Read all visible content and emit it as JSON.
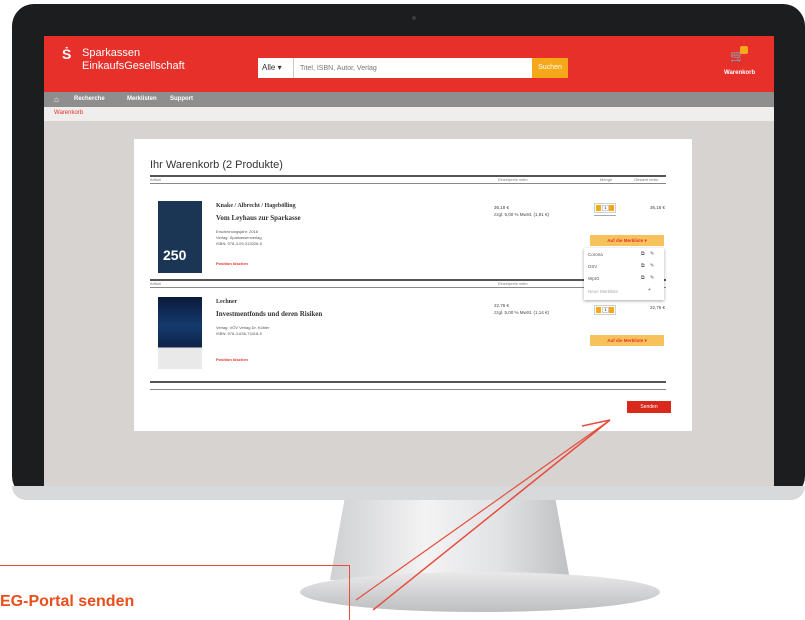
{
  "header": {
    "brand_line1": "Sparkassen",
    "brand_line2": "EinkaufsGesellschaft",
    "search_scope": "Alle",
    "search_placeholder": "Titel, ISBN, Autor, Verlag",
    "search_button": "Suchen",
    "cart_label": "Warenkorb"
  },
  "nav": {
    "items": [
      "Recherche",
      "Merklisten",
      "Support"
    ]
  },
  "breadcrumb": "Warenkorb",
  "cart": {
    "title": "Ihr Warenkorb (2 Produkte)",
    "col_article": "Artikel",
    "col_unit_price": "Einzelpreis netto",
    "col_quantity": "Menge",
    "col_total": "Gesamt netto",
    "items": [
      {
        "author": "Knake / Albrecht / Hagebölling",
        "title": "Vom Leyhaus zur Sparkasse",
        "meta": [
          "Erscheinungsjahr: 2016",
          "Verlag: Sparkassenverlag",
          "ISBN: 978-3-09-313026-5"
        ],
        "price": "36,18 €",
        "price_note": "zzgl. 5,00 % MwSt. (1,81 €)",
        "quantity": "1",
        "total": "36,18 €",
        "cover_number": "250",
        "remove_link": "Position löschen",
        "merkliste_button": "Auf die Merkliste"
      },
      {
        "author": "Lechner",
        "title": "Investmentfonds und deren Risiken",
        "meta": [
          "Verlag: VÖV Verlag Dr. Köhler",
          "ISBN: 978-3-636-73418-9"
        ],
        "price": "22,76 €",
        "price_note": "zzgl. 5,00 % MwSt. (1,14 €)",
        "quantity": "1",
        "total": "22,76 €",
        "remove_link": "Position löschen",
        "merkliste_button": "Auf die Merkliste"
      }
    ],
    "merklisten": [
      "Corona",
      "DSV",
      "WpIG"
    ],
    "new_merkliste": "Neue Merkliste",
    "send_button": "Senden"
  },
  "callout_text": "EG-Portal senden",
  "colors": {
    "brand_red": "#e7302a",
    "accent_orange": "#f6a81b",
    "callout_orange": "#e94e1b"
  }
}
